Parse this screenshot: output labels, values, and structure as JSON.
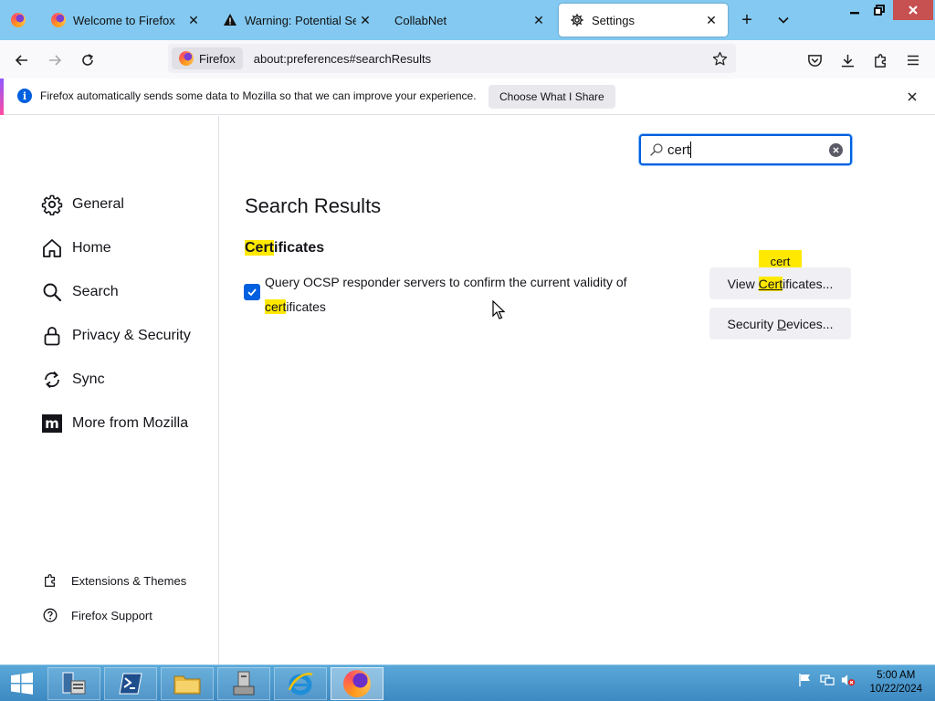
{
  "tabs": [
    {
      "title": "Welcome to Firefox",
      "icon": "firefox-icon",
      "active": false
    },
    {
      "title": "Warning: Potential Secur",
      "icon": "warning-icon",
      "active": false
    },
    {
      "title": "CollabNet",
      "icon": "",
      "active": false
    },
    {
      "title": "Settings",
      "icon": "gear-icon",
      "active": true
    }
  ],
  "navbar": {
    "identity_label": "Firefox",
    "url": "about:preferences#searchResults"
  },
  "notification": {
    "message": "Firefox automatically sends some data to Mozilla so that we can improve your experience.",
    "button_label": "Choose What I Share"
  },
  "sidebar": {
    "categories": [
      {
        "label": "General",
        "icon": "gear-icon"
      },
      {
        "label": "Home",
        "icon": "home-icon"
      },
      {
        "label": "Search",
        "icon": "search-icon"
      },
      {
        "label": "Privacy & Security",
        "icon": "lock-icon"
      },
      {
        "label": "Sync",
        "icon": "sync-icon"
      },
      {
        "label": "More from Mozilla",
        "icon": "mozilla-icon"
      }
    ],
    "footer": [
      {
        "label": "Extensions & Themes",
        "icon": "puzzle-icon"
      },
      {
        "label": "Firefox Support",
        "icon": "help-icon"
      }
    ]
  },
  "search": {
    "value": "cert"
  },
  "results": {
    "title": "Search Results",
    "section": {
      "highlight": "Cert",
      "rest": "ificates"
    },
    "ocsp": {
      "checked": true,
      "text_line1": "Query OCSP responder servers to confirm the current validity of",
      "text_highlight": "cert",
      "text_rest": "ificates"
    },
    "view_certs": {
      "prefix": "View ",
      "highlight": "Cert",
      "rest": "ificates..."
    },
    "security_devices": {
      "prefix": "Security ",
      "underlined": "D",
      "rest": "evices..."
    },
    "tooltip": "cert"
  },
  "taskbar": {
    "time": "5:00 AM",
    "date": "10/22/2024"
  },
  "colors": {
    "accent": "#0060df",
    "highlight": "#ffe900",
    "tabstrip": "#83c9f1",
    "taskbar": "#3d89c2"
  }
}
